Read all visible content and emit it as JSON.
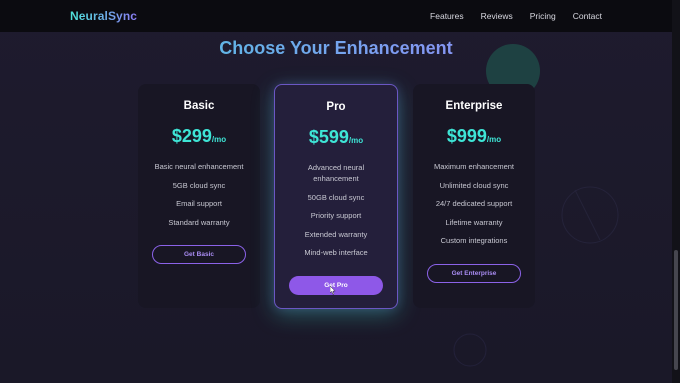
{
  "brand": {
    "name": "NeuralSync"
  },
  "nav": {
    "links": [
      "Features",
      "Reviews",
      "Pricing",
      "Contact"
    ]
  },
  "section": {
    "title": "Choose Your Enhancement"
  },
  "plans": [
    {
      "name": "Basic",
      "price": "$299",
      "period": "/mo",
      "features": [
        "Basic neural enhancement",
        "5GB cloud sync",
        "Email support",
        "Standard warranty"
      ],
      "cta": "Get Basic"
    },
    {
      "name": "Pro",
      "price": "$599",
      "period": "/mo",
      "features": [
        "Advanced neural enhancement",
        "50GB cloud sync",
        "Priority support",
        "Extended warranty",
        "Mind-web interface"
      ],
      "cta": "Get Pro"
    },
    {
      "name": "Enterprise",
      "price": "$999",
      "period": "/mo",
      "features": [
        "Maximum enhancement",
        "Unlimited cloud sync",
        "24/7 dedicated support",
        "Lifetime warranty",
        "Custom integrations"
      ],
      "cta": "Get Enterprise"
    }
  ],
  "colors": {
    "accent_teal": "#3ee5d6",
    "accent_purple": "#8e58e8",
    "background": "#1e1b2e"
  }
}
